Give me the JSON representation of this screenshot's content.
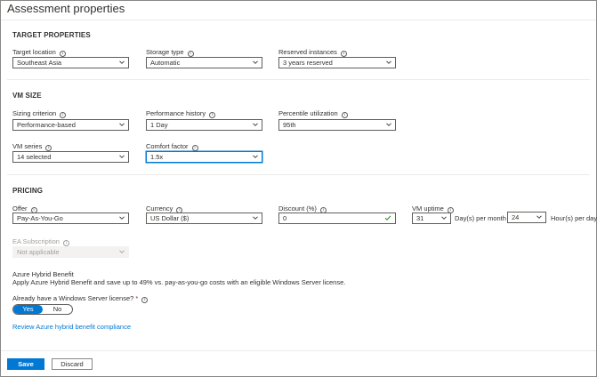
{
  "page": {
    "title": "Assessment properties"
  },
  "target_properties": {
    "heading": "TARGET PROPERTIES",
    "target_location": {
      "label": "Target location",
      "value": "Southeast Asia"
    },
    "storage_type": {
      "label": "Storage type",
      "value": "Automatic"
    },
    "reserved_instances": {
      "label": "Reserved instances",
      "value": "3 years reserved"
    }
  },
  "vm_size": {
    "heading": "VM SIZE",
    "sizing_criterion": {
      "label": "Sizing criterion",
      "value": "Performance-based"
    },
    "performance_history": {
      "label": "Performance history",
      "value": "1 Day"
    },
    "percentile_utilization": {
      "label": "Percentile utilization",
      "value": "95th"
    },
    "vm_series": {
      "label": "VM series",
      "value": "14 selected"
    },
    "comfort_factor": {
      "label": "Comfort factor",
      "value": "1.5x"
    }
  },
  "pricing": {
    "heading": "PRICING",
    "offer": {
      "label": "Offer",
      "value": "Pay-As-You-Go"
    },
    "currency": {
      "label": "Currency",
      "value": "US Dollar ($)"
    },
    "discount": {
      "label": "Discount (%)",
      "value": "0"
    },
    "vm_uptime": {
      "label": "VM uptime",
      "days_value": "31",
      "days_suffix": "Day(s) per month",
      "hours_value": "24",
      "hours_suffix": "Hour(s) per day"
    },
    "ea_subscription": {
      "label": "EA Subscription",
      "value": "Not applicable"
    },
    "hybrid_benefit": {
      "title": "Azure Hybrid Benefit",
      "description": "Apply Azure Hybrid Benefit and save up to 49% vs. pay-as-you-go costs with an eligible Windows Server license.",
      "question": "Already have a Windows Server license?",
      "required_mark": "*",
      "yes_label": "Yes",
      "no_label": "No",
      "selected": "Yes",
      "review_link": "Review Azure hybrid benefit compliance"
    }
  },
  "footer": {
    "save_label": "Save",
    "discard_label": "Discard"
  },
  "icons": {
    "info": "info-icon",
    "chevron": "chevron-down-icon",
    "check": "check-icon"
  },
  "colors": {
    "accent": "#0078d4",
    "success": "#107c10",
    "required": "#a4262c"
  }
}
